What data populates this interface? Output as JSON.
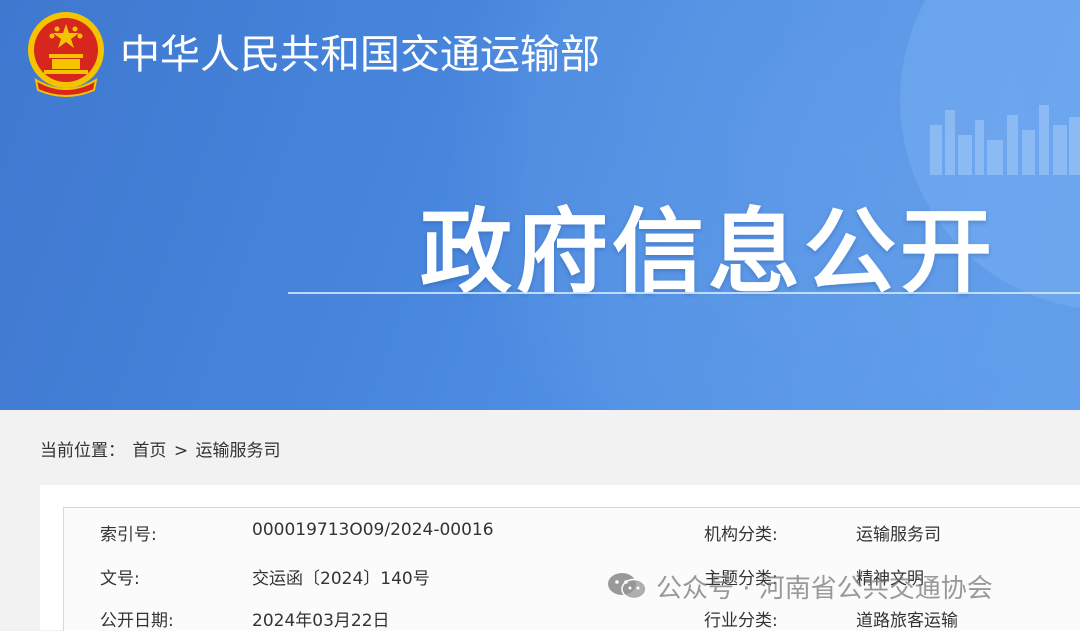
{
  "header": {
    "ministry_name": "中华人民共和国交通运输部",
    "section_title": "政府信息公开"
  },
  "breadcrumb": {
    "prefix": "当前位置：",
    "home": "首页",
    "separator": ">",
    "current": "运输服务司"
  },
  "info": {
    "index_label": "索引号:",
    "index_value": "000019713O09/2024-00016",
    "org_label": "机构分类:",
    "org_value": "运输服务司",
    "doc_label": "文号:",
    "doc_value": "交运函〔2024〕140号",
    "topic_label": "主题分类:",
    "topic_value": "精神文明",
    "date_label": "公开日期:",
    "date_value": "2024年03月22日",
    "industry_label": "行业分类:",
    "industry_value": "道路旅客运输"
  },
  "watermark": {
    "text": "公众号 · 河南省公共交通协会"
  },
  "colors": {
    "banner_blue": "#4785dc",
    "emblem_red": "#d7261e",
    "emblem_gold": "#f5c400"
  }
}
